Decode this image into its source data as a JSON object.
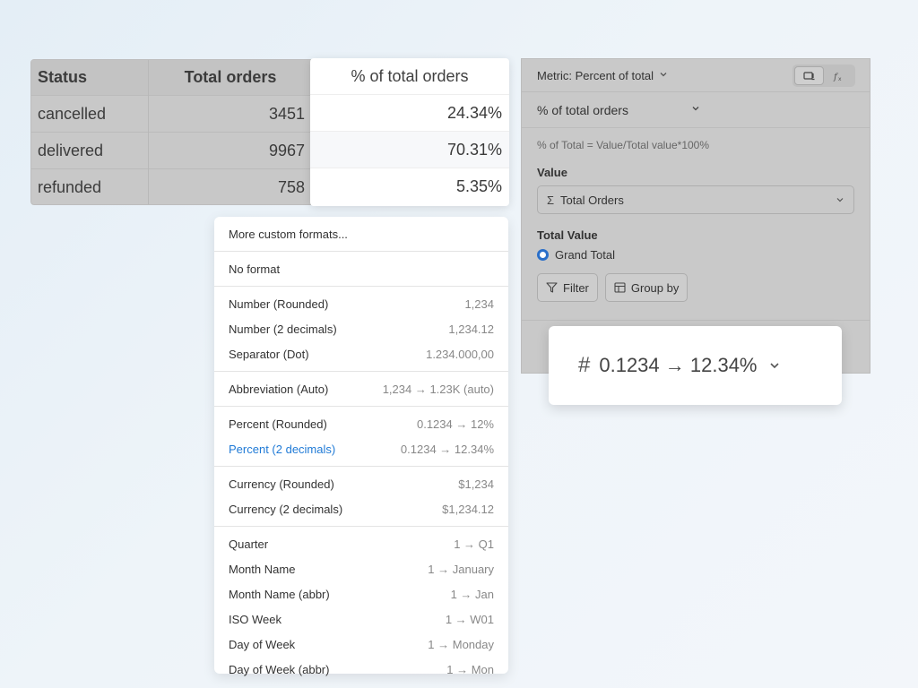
{
  "table": {
    "headers": [
      "Status",
      "Total orders",
      "% of total orders"
    ],
    "rows": [
      {
        "status": "cancelled",
        "total": "3451",
        "pct": "24.34%"
      },
      {
        "status": "delivered",
        "total": "9967",
        "pct": "70.31%"
      },
      {
        "status": "refunded",
        "total": "758",
        "pct": "5.35%"
      }
    ]
  },
  "format_menu": {
    "sections": [
      [
        {
          "label": "More custom formats...",
          "example": ""
        }
      ],
      [
        {
          "label": "No format",
          "example": ""
        }
      ],
      [
        {
          "label": "Number (Rounded)",
          "example": "1,234"
        },
        {
          "label": "Number (2 decimals)",
          "example": "1,234.12"
        },
        {
          "label": "Separator (Dot)",
          "example": "1.234.000,00"
        }
      ],
      [
        {
          "label": "Abbreviation (Auto)",
          "example": "1,234 → 1.23K (auto)"
        }
      ],
      [
        {
          "label": "Percent (Rounded)",
          "example": "0.1234 → 12%"
        },
        {
          "label": "Percent (2 decimals)",
          "example": "0.1234 → 12.34%",
          "active": true
        }
      ],
      [
        {
          "label": "Currency (Rounded)",
          "example": "$1,234"
        },
        {
          "label": "Currency (2 decimals)",
          "example": "$1,234.12"
        }
      ],
      [
        {
          "label": "Quarter",
          "example": "1 → Q1"
        },
        {
          "label": "Month Name",
          "example": "1 → January"
        },
        {
          "label": "Month Name (abbr)",
          "example": "1 → Jan"
        },
        {
          "label": "ISO Week",
          "example": "1 → W01"
        },
        {
          "label": "Day of Week",
          "example": "1 → Monday"
        },
        {
          "label": "Day of Week (abbr)",
          "example": "1 → Mon"
        }
      ]
    ]
  },
  "panel": {
    "metric_label": "Metric: Percent of total",
    "field_name": "% of total orders",
    "formula": "% of Total = Value/Total value*100%",
    "value_label": "Value",
    "value_select": "Total Orders",
    "total_value_label": "Total Value",
    "total_value_option": "Grand Total",
    "filter_label": "Filter",
    "groupby_label": "Group by"
  },
  "format_chip": {
    "value": "0.1234 → 12.34%"
  },
  "colors": {
    "accent": "#1f7ad6",
    "radio": "#2a6fc9"
  }
}
